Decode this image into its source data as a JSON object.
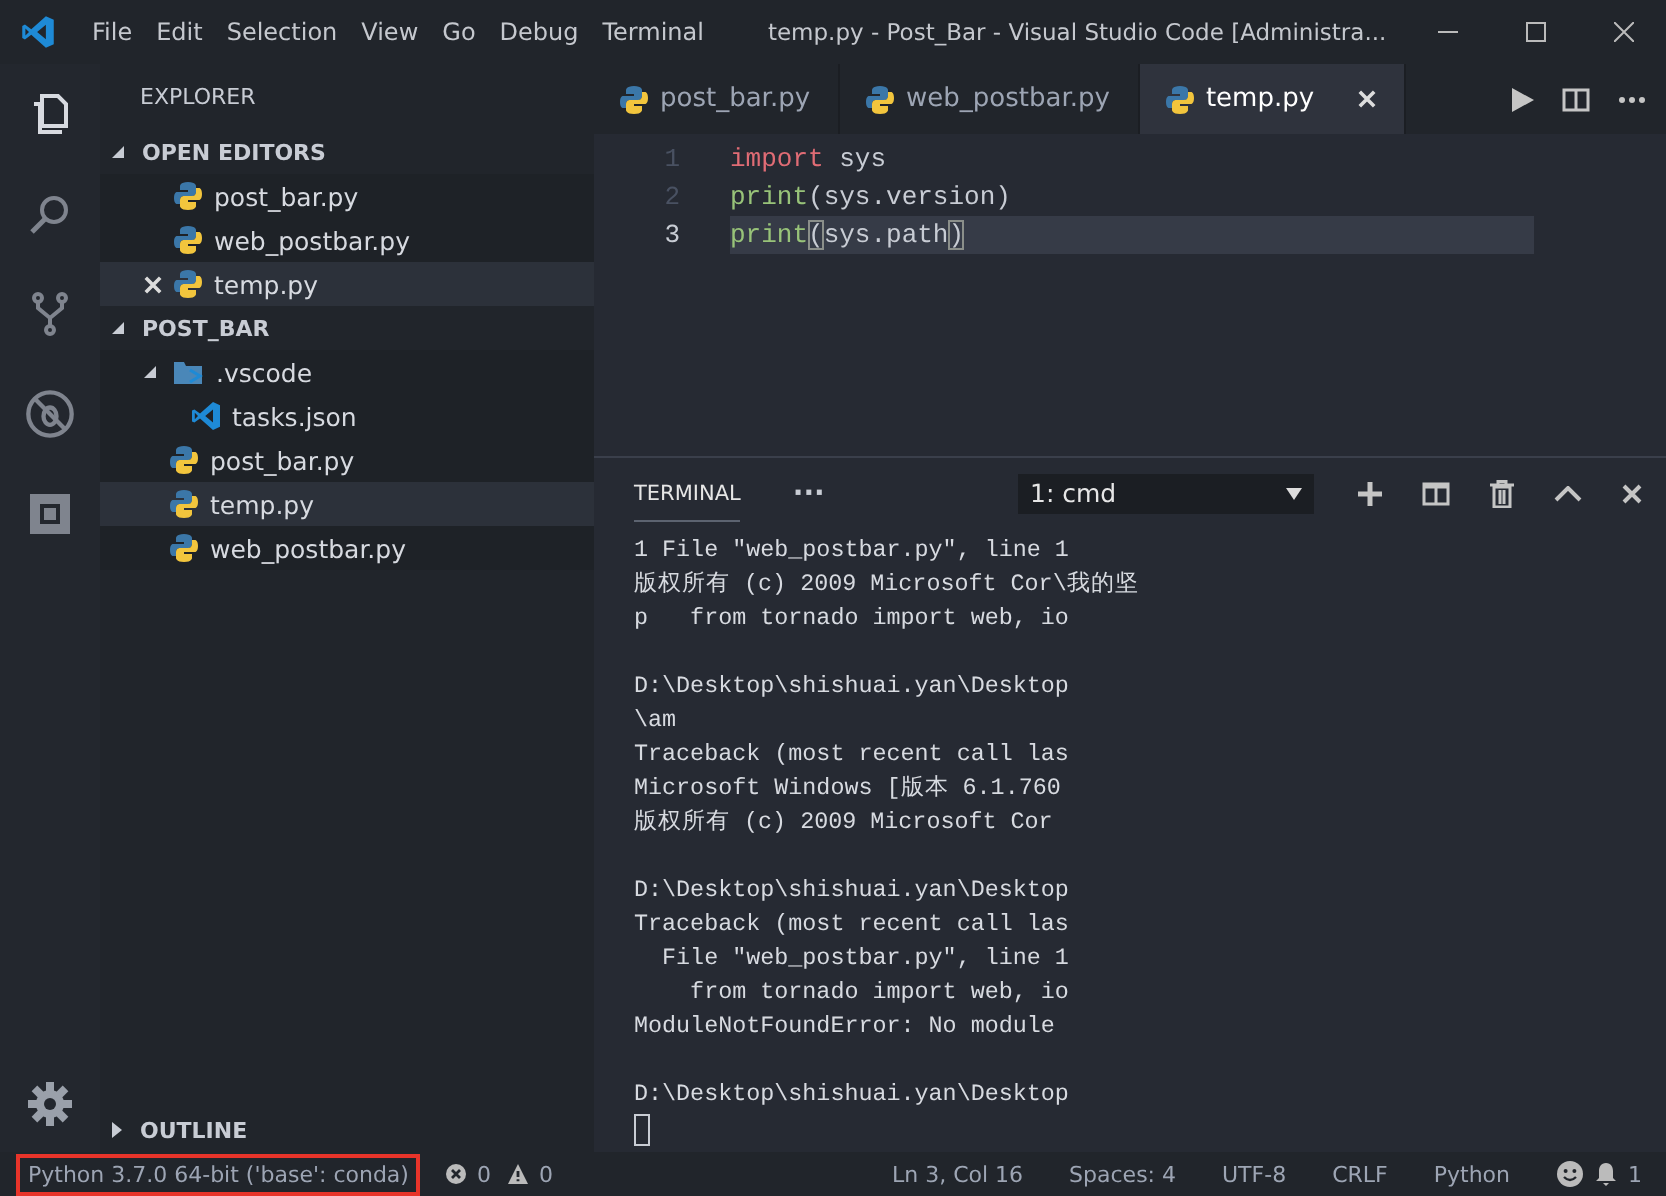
{
  "window": {
    "title": "temp.py - Post_Bar - Visual Studio Code [Administra..."
  },
  "menu": [
    "File",
    "Edit",
    "Selection",
    "View",
    "Go",
    "Debug",
    "Terminal"
  ],
  "activity_bar": [
    {
      "kind": "files",
      "selected": true
    },
    {
      "kind": "search",
      "selected": false
    },
    {
      "kind": "scm",
      "selected": false
    },
    {
      "kind": "debug",
      "selected": false
    },
    {
      "kind": "extensions",
      "selected": false
    }
  ],
  "sidebar": {
    "title": "EXPLORER",
    "open_editors": {
      "title": "OPEN EDITORS",
      "expanded": true,
      "items": [
        {
          "name": "post_bar.py",
          "kind": "python",
          "selected": false
        },
        {
          "name": "web_postbar.py",
          "kind": "python",
          "selected": false
        },
        {
          "name": "temp.py",
          "kind": "python",
          "selected": true
        }
      ]
    },
    "folder": {
      "title": "POST_BAR",
      "expanded": true,
      "items": [
        {
          "name": ".vscode",
          "kind": "folder",
          "expanded": true,
          "selected": false,
          "children": [
            {
              "name": "tasks.json",
              "kind": "vscode",
              "selected": false
            }
          ]
        },
        {
          "name": "post_bar.py",
          "kind": "python",
          "selected": false
        },
        {
          "name": "temp.py",
          "kind": "python",
          "selected": true
        },
        {
          "name": "web_postbar.py",
          "kind": "python",
          "selected": false
        }
      ]
    },
    "outline": {
      "title": "OUTLINE",
      "expanded": false
    }
  },
  "tabs": [
    {
      "label": "post_bar.py",
      "selected": false
    },
    {
      "label": "web_postbar.py",
      "selected": false
    },
    {
      "label": "temp.py",
      "selected": true
    }
  ],
  "editor": {
    "lines": [
      {
        "number": "1",
        "current": false,
        "tokens": [
          {
            "kind": "keyword",
            "text": "import"
          },
          {
            "kind": "plain",
            "text": " sys"
          }
        ]
      },
      {
        "number": "2",
        "current": false,
        "tokens": [
          {
            "kind": "function",
            "text": "print"
          },
          {
            "kind": "plain",
            "text": "(sys.version)"
          }
        ]
      },
      {
        "number": "3",
        "current": true,
        "tokens": [
          {
            "kind": "function",
            "text": "print"
          },
          {
            "kind": "bracket",
            "text": "("
          },
          {
            "kind": "plain",
            "text": "sys.path"
          },
          {
            "kind": "bracket",
            "text": ")"
          }
        ]
      }
    ]
  },
  "panel": {
    "tabs": [
      {
        "label": "TERMINAL",
        "selected": true
      }
    ],
    "more": "···",
    "terminal_select": "1: cmd",
    "blocks": [
      [
        "1 File \"web_postbar.py\", line 1",
        "版权所有 (c) 2009 Microsoft Cor\\我的坚",
        "p   from tornado import web, io"
      ],
      [
        "D:\\Desktop\\shishuai.yan\\Desktop",
        "\\am",
        "Traceback (most recent call las",
        "Microsoft Windows [版本 6.1.760",
        "版权所有 (c) 2009 Microsoft Cor"
      ],
      [
        "D:\\Desktop\\shishuai.yan\\Desktop",
        "Traceback (most recent call las",
        "  File \"web_postbar.py\", line 1",
        "    from tornado import web, io",
        "ModuleNotFoundError: No module"
      ],
      [
        "D:\\Desktop\\shishuai.yan\\Desktop"
      ]
    ]
  },
  "status_bar": {
    "interpreter": {
      "text": "Python 3.7.0 64-bit ('base': conda)",
      "highlighted": true
    },
    "errors": "0",
    "warnings": "0",
    "right": [
      "Ln 3, Col 16",
      "Spaces: 4",
      "UTF-8",
      "CRLF",
      "Python"
    ],
    "notifications": "1"
  }
}
